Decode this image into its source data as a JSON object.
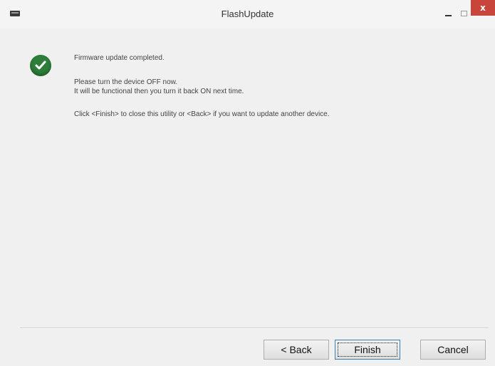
{
  "window": {
    "title": "FlashUpdate",
    "close_glyph": "x"
  },
  "message": {
    "line1": "Firmware update completed.",
    "line2": "Please turn the device OFF now.",
    "line3": "It will be functional then you turn it back ON next time.",
    "line4": "Click <Finish> to close this utility or <Back> if you want to update another device."
  },
  "buttons": {
    "back": "< Back",
    "finish": "Finish",
    "cancel": "Cancel"
  },
  "colors": {
    "close_button": "#c7453a",
    "success_icon": "#2e7d3a"
  }
}
